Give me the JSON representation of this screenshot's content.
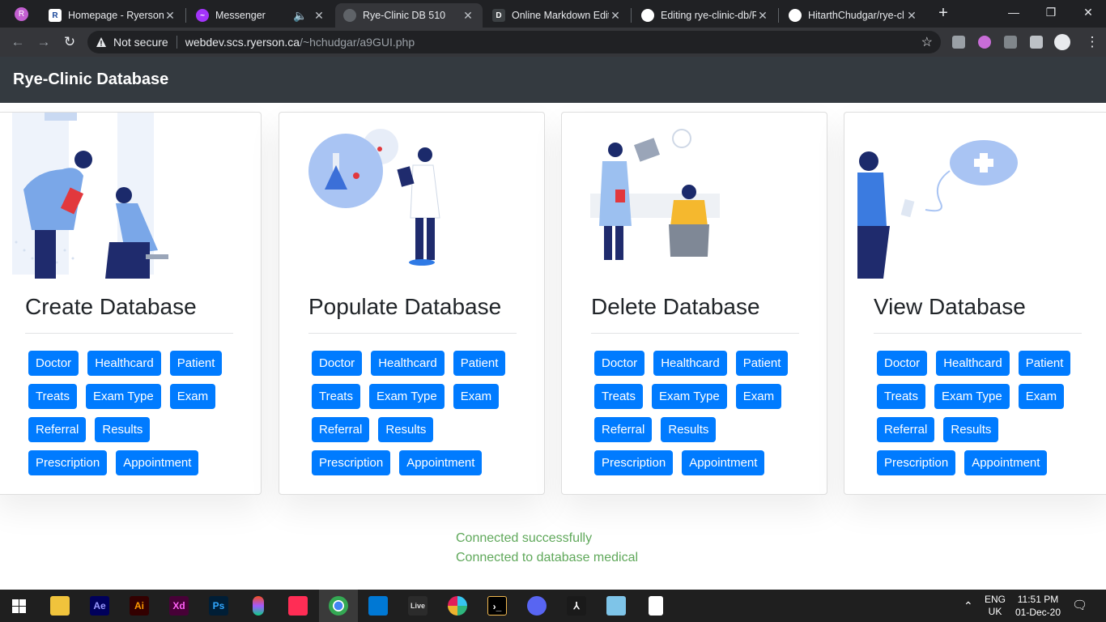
{
  "browser": {
    "tabs": [
      {
        "title": "Homepage - Ryerson U",
        "icon": "ryerson-icon"
      },
      {
        "title": "Messenger",
        "icon": "messenger-icon"
      },
      {
        "title": "Rye-Clinic DB 510",
        "icon": "globe-icon"
      },
      {
        "title": "Online Markdown Edit",
        "icon": "dillinger-icon"
      },
      {
        "title": "Editing rye-clinic-db/R",
        "icon": "github-icon"
      },
      {
        "title": "HitarthChudgar/rye-cl",
        "icon": "github-icon"
      }
    ],
    "security_label": "Not secure",
    "url_domain": "webdev.scs.ryerson.ca",
    "url_path": "/~hchudgar/a9GUI.php"
  },
  "page": {
    "brand": "Rye-Clinic Database",
    "cards": [
      {
        "title": "Create Database"
      },
      {
        "title": "Populate Database"
      },
      {
        "title": "Delete Database"
      },
      {
        "title": "View Database"
      }
    ],
    "button_rows": [
      [
        "Doctor",
        "Healthcard",
        "Patient"
      ],
      [
        "Treats",
        "Exam Type",
        "Exam"
      ],
      [
        "Referral",
        "Results"
      ],
      [
        "Prescription",
        "Appointment"
      ]
    ],
    "status_lines": [
      "Connected successfully",
      "Connected to database medical"
    ]
  },
  "taskbar": {
    "apps": [
      "file-explorer",
      "after-effects",
      "illustrator",
      "adobe-xd",
      "photoshop",
      "figma",
      "app-red",
      "chrome",
      "vscode",
      "live",
      "slack",
      "terminal",
      "discord",
      "acrobat",
      "notepad",
      "file"
    ],
    "labels": {
      "ae": "Ae",
      "ai": "Ai",
      "xd": "Xd",
      "ps": "Ps",
      "live": "Live"
    },
    "language": "ENG",
    "region": "UK",
    "time": "11:51 PM",
    "date": "01-Dec-20"
  },
  "colors": {
    "primary_button": "#007bff",
    "navbar": "#343a40",
    "status_text": "#5fa85a"
  }
}
